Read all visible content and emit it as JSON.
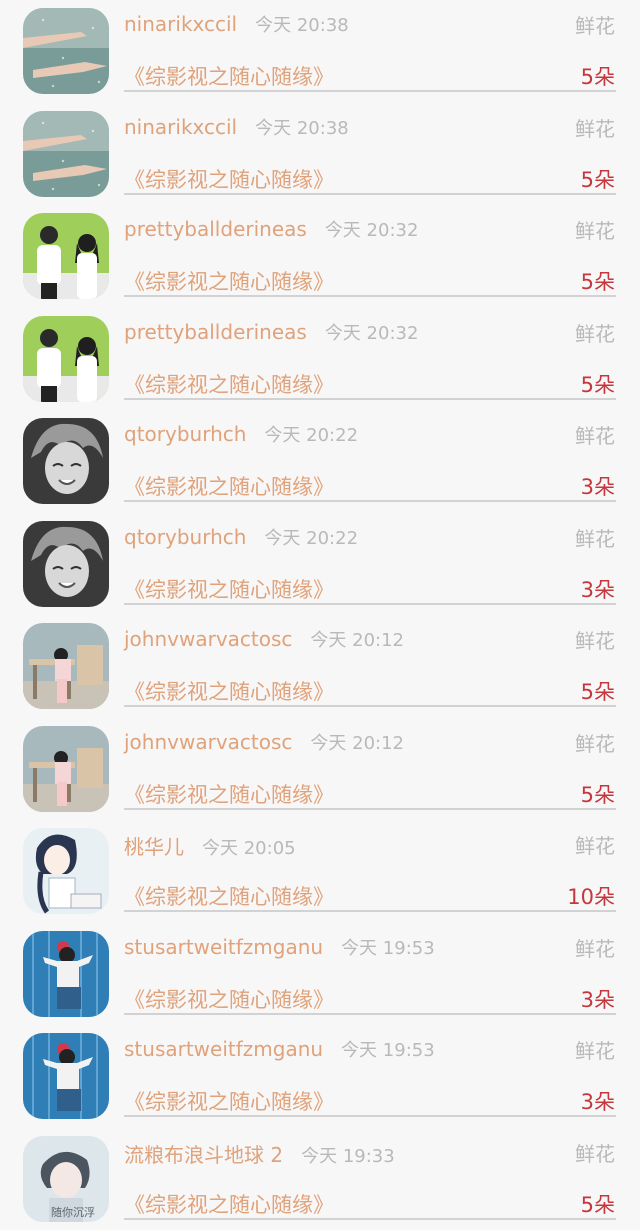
{
  "records": [
    {
      "username": "ninarikxccil",
      "time": "今天 20:38",
      "gift": "鲜花",
      "book": "《综影视之随心随缘》",
      "count": "5朵",
      "avatar": "rain-hands-avatar",
      "avatar_colors": [
        "#7a9c98",
        "#c9d6d2"
      ]
    },
    {
      "username": "ninarikxccil",
      "time": "今天 20:38",
      "gift": "鲜花",
      "book": "《综影视之随心随缘》",
      "count": "5朵",
      "avatar": "rain-hands-avatar",
      "avatar_colors": [
        "#7a9c98",
        "#c9d6d2"
      ]
    },
    {
      "username": "prettyballderineas",
      "time": "今天 20:32",
      "gift": "鲜花",
      "book": "《综影视之随心随缘》",
      "count": "5朵",
      "avatar": "couple-avatar",
      "avatar_colors": [
        "#9fcf5a",
        "#ffffff"
      ]
    },
    {
      "username": "prettyballderineas",
      "time": "今天 20:32",
      "gift": "鲜花",
      "book": "《综影视之随心随缘》",
      "count": "5朵",
      "avatar": "couple-avatar",
      "avatar_colors": [
        "#9fcf5a",
        "#ffffff"
      ]
    },
    {
      "username": "qtoryburhch",
      "time": "今天 20:22",
      "gift": "鲜花",
      "book": "《综影视之随心随缘》",
      "count": "3朵",
      "avatar": "anime-boy-avatar",
      "avatar_colors": [
        "#3a3a3a",
        "#d8d8d8"
      ]
    },
    {
      "username": "qtoryburhch",
      "time": "今天 20:22",
      "gift": "鲜花",
      "book": "《综影视之随心随缘》",
      "count": "3朵",
      "avatar": "anime-boy-avatar",
      "avatar_colors": [
        "#3a3a3a",
        "#d8d8d8"
      ]
    },
    {
      "username": "johnvwarvactosc",
      "time": "今天 20:12",
      "gift": "鲜花",
      "book": "《综影视之随心随缘》",
      "count": "5朵",
      "avatar": "desk-girl-avatar",
      "avatar_colors": [
        "#a8b9bd",
        "#d9c4a8"
      ]
    },
    {
      "username": "johnvwarvactosc",
      "time": "今天 20:12",
      "gift": "鲜花",
      "book": "《综影视之随心随缘》",
      "count": "5朵",
      "avatar": "desk-girl-avatar",
      "avatar_colors": [
        "#a8b9bd",
        "#d9c4a8"
      ]
    },
    {
      "username": "桃华儿",
      "time": "今天 20:05",
      "gift": "鲜花",
      "book": "《综影视之随心随缘》",
      "count": "10朵",
      "avatar": "drawn-girl-avatar",
      "avatar_colors": [
        "#e9f0f4",
        "#2a3550"
      ]
    },
    {
      "username": "stusartweitfzmganu",
      "time": "今天 19:53",
      "gift": "鲜花",
      "book": "《综影视之随心随缘》",
      "count": "3朵",
      "avatar": "wall-girl-avatar",
      "avatar_colors": [
        "#2f7fb6",
        "#f2f2f2"
      ]
    },
    {
      "username": "stusartweitfzmganu",
      "time": "今天 19:53",
      "gift": "鲜花",
      "book": "《综影视之随心随缘》",
      "count": "3朵",
      "avatar": "wall-girl-avatar",
      "avatar_colors": [
        "#2f7fb6",
        "#f2f2f2"
      ]
    },
    {
      "username": "流粮布浪斗地球 2",
      "time": "今天 19:33",
      "gift": "鲜花",
      "book": "《综影视之随心随缘》",
      "count": "5朵",
      "avatar": "sketch-boy-avatar",
      "avatar_colors": [
        "#dde6ea",
        "#5a6570"
      ],
      "avatar_caption": "随你沉浮"
    }
  ]
}
